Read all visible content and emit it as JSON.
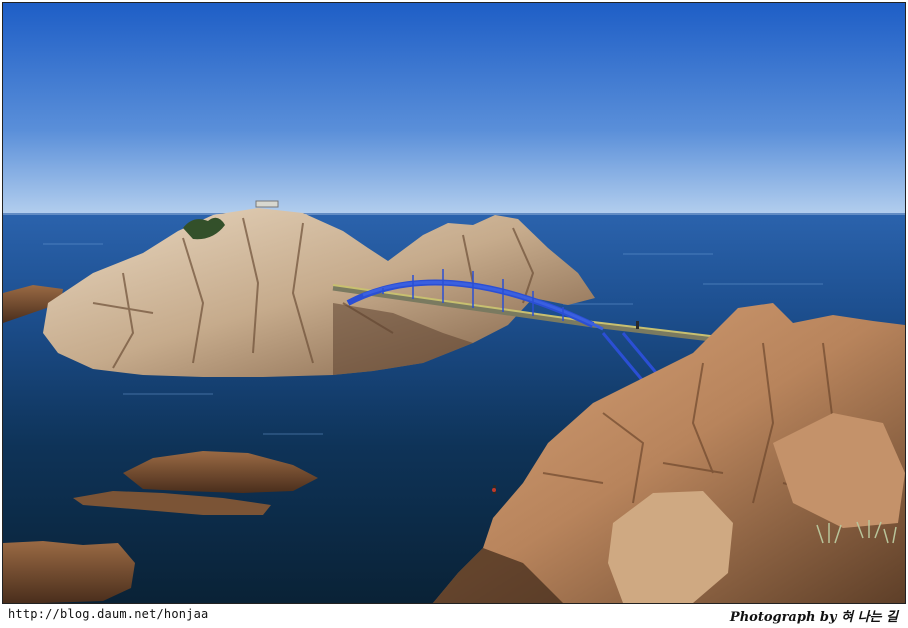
{
  "watermark": {
    "url": "http://blog.daum.net/honjaa",
    "credit": "Photograph by 혀 나는 길"
  },
  "scene": {
    "subject": "coastal rocks with arched footbridge",
    "colors": {
      "sky_top": "#1f5fc4",
      "sky_bottom": "#a9c8ec",
      "sea_far": "#2a5fa6",
      "sea_near": "#0b2a4a",
      "rock": "#c9a27c",
      "bridge": "#2a4fd0"
    }
  }
}
